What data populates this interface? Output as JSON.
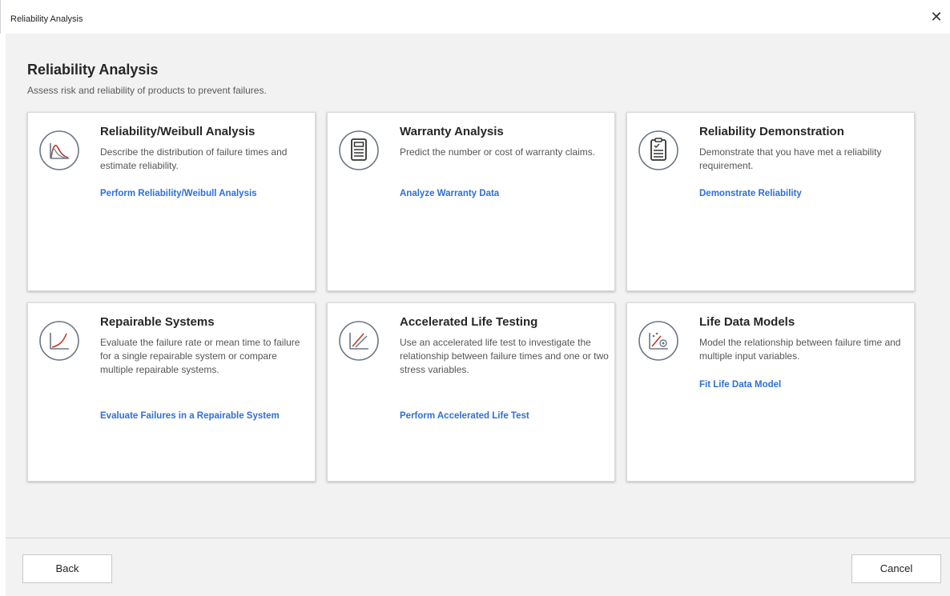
{
  "window": {
    "title": "Reliability Analysis",
    "close_glyph": "✕"
  },
  "header": {
    "title": "Reliability Analysis",
    "subtitle": "Assess risk and reliability of products to prevent failures."
  },
  "cards": [
    {
      "icon": "weibull-distribution-icon",
      "title": "Reliability/Weibull Analysis",
      "description": "Describe the distribution of failure times and estimate reliability.",
      "link": "Perform Reliability/Weibull Analysis"
    },
    {
      "icon": "warranty-document-icon",
      "title": "Warranty Analysis",
      "description": "Predict the number or cost of warranty claims.",
      "link": "Analyze Warranty Data"
    },
    {
      "icon": "clipboard-check-icon",
      "title": "Reliability Demonstration",
      "description": "Demonstrate that you have met a reliability requirement.",
      "link": "Demonstrate Reliability"
    },
    {
      "icon": "growth-curve-icon",
      "title": "Repairable Systems",
      "description": "Evaluate the failure rate or mean time to failure for a single repairable system or compare multiple repairable systems.",
      "link": "Evaluate Failures in a Repairable System"
    },
    {
      "icon": "accelerated-lines-icon",
      "title": "Accelerated Life Testing",
      "description": "Use an accelerated life test to investigate the relationship between failure times and one or two stress variables.",
      "link": "Perform Accelerated Life Test"
    },
    {
      "icon": "life-data-model-icon",
      "title": "Life Data Models",
      "description": "Model the relationship between failure time and multiple input variables.",
      "link": "Fit Life Data Model"
    }
  ],
  "footer": {
    "back_label": "Back",
    "cancel_label": "Cancel"
  },
  "colors": {
    "accent_red": "#c0392b",
    "link_blue": "#2f6fd6",
    "icon_gray": "#6b7683"
  }
}
